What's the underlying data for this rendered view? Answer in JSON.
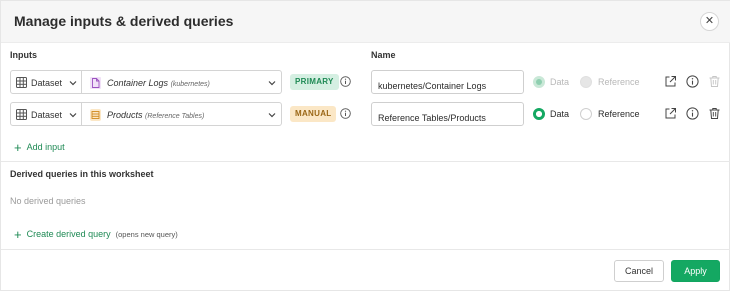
{
  "dialog": {
    "title": "Manage inputs & derived queries",
    "close_symbol": "✕"
  },
  "columns": {
    "inputs": "Inputs",
    "name": "Name"
  },
  "inputs": [
    {
      "type_label": "Dataset",
      "source_name": "Container Logs",
      "source_sub": "(kubernetes)",
      "source_icon": "document-icon",
      "badge": "PRIMARY",
      "name_value": "kubernetes/Container Logs",
      "radio_data": "Data",
      "radio_reference": "Reference",
      "selected": "Data",
      "disabled": true
    },
    {
      "type_label": "Dataset",
      "source_name": "Products",
      "source_sub": "(Reference Tables)",
      "source_icon": "table-icon",
      "badge": "MANUAL",
      "name_value": "Reference Tables/Products",
      "radio_data": "Data",
      "radio_reference": "Reference",
      "selected": "Data",
      "disabled": false
    }
  ],
  "add_input": "Add input",
  "derived": {
    "heading": "Derived queries in this worksheet",
    "empty": "No derived queries",
    "create": "Create derived query",
    "create_hint": "(opens new query)"
  },
  "footer": {
    "cancel": "Cancel",
    "apply": "Apply"
  },
  "colors": {
    "accent": "#14a862",
    "primary_badge_bg": "#d5efe2",
    "manual_badge_bg": "#fbe7c6"
  }
}
